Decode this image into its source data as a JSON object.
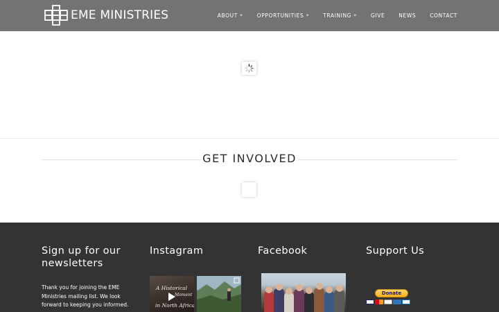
{
  "header": {
    "brand_name": "EME MINISTRIES",
    "nav": [
      {
        "label": "ABOUT",
        "has_dropdown": true
      },
      {
        "label": "OPPORTUNITIES",
        "has_dropdown": true
      },
      {
        "label": "TRAINING",
        "has_dropdown": true
      },
      {
        "label": "GIVE",
        "has_dropdown": false
      },
      {
        "label": "NEWS",
        "has_dropdown": false
      },
      {
        "label": "CONTACT",
        "has_dropdown": false
      }
    ]
  },
  "involved": {
    "title": "GET INVOLVED"
  },
  "footer": {
    "newsletter": {
      "title": "Sign up for our newsletters",
      "text": "Thank you for joining the EME Ministries mailing list. We look forward to keeping you informed."
    },
    "instagram": {
      "title": "Instagram",
      "post1_text": [
        "A Historical",
        "Moment",
        "in North Africa"
      ]
    },
    "facebook": {
      "title": "Facebook"
    },
    "support": {
      "title": "Support Us",
      "donate_label": "Donate"
    }
  },
  "colors": {
    "header_bg": "#737373",
    "footer_bg": "#333333",
    "donate_gold": "#f7b11b"
  },
  "icons": [
    "brand-logo-icon",
    "chevron-double-down-icon",
    "loading-spinner-icon",
    "play-icon",
    "card-icons"
  ]
}
